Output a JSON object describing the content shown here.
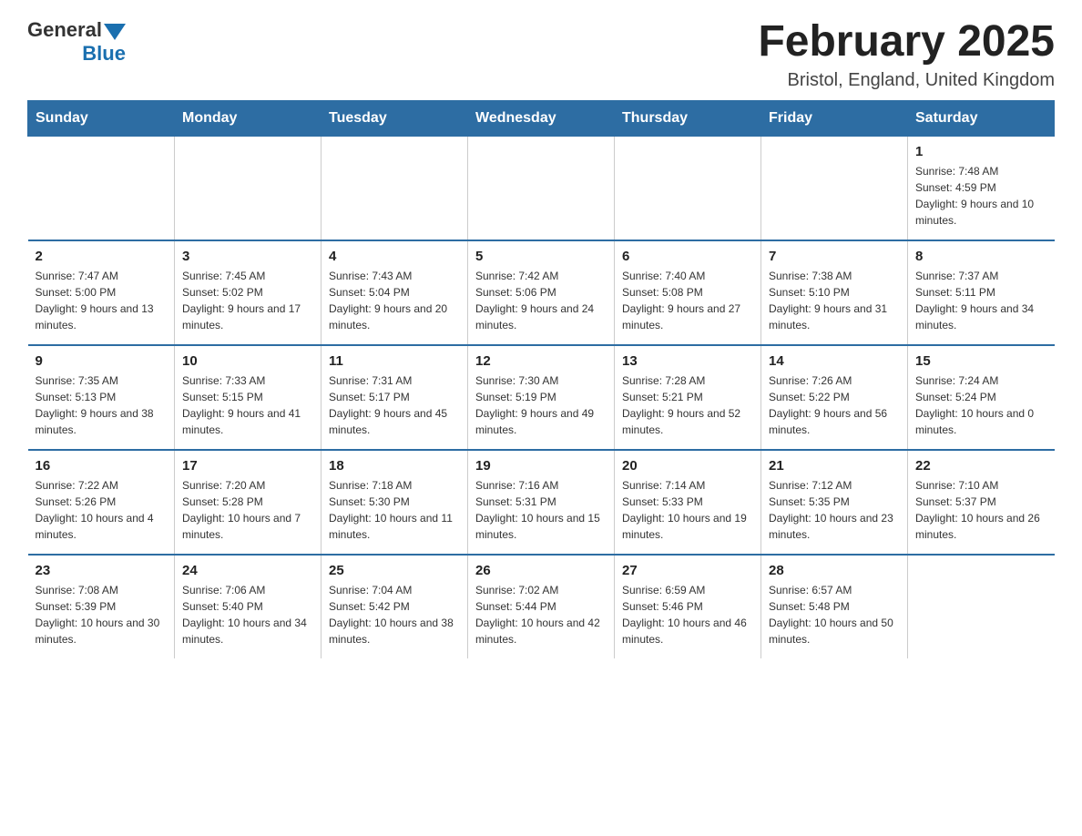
{
  "logo": {
    "text_general": "General",
    "text_blue": "Blue"
  },
  "header": {
    "title": "February 2025",
    "location": "Bristol, England, United Kingdom"
  },
  "weekdays": [
    "Sunday",
    "Monday",
    "Tuesday",
    "Wednesday",
    "Thursday",
    "Friday",
    "Saturday"
  ],
  "weeks": [
    {
      "days": [
        {
          "number": "",
          "info": ""
        },
        {
          "number": "",
          "info": ""
        },
        {
          "number": "",
          "info": ""
        },
        {
          "number": "",
          "info": ""
        },
        {
          "number": "",
          "info": ""
        },
        {
          "number": "",
          "info": ""
        },
        {
          "number": "1",
          "info": "Sunrise: 7:48 AM\nSunset: 4:59 PM\nDaylight: 9 hours and 10 minutes."
        }
      ]
    },
    {
      "days": [
        {
          "number": "2",
          "info": "Sunrise: 7:47 AM\nSunset: 5:00 PM\nDaylight: 9 hours and 13 minutes."
        },
        {
          "number": "3",
          "info": "Sunrise: 7:45 AM\nSunset: 5:02 PM\nDaylight: 9 hours and 17 minutes."
        },
        {
          "number": "4",
          "info": "Sunrise: 7:43 AM\nSunset: 5:04 PM\nDaylight: 9 hours and 20 minutes."
        },
        {
          "number": "5",
          "info": "Sunrise: 7:42 AM\nSunset: 5:06 PM\nDaylight: 9 hours and 24 minutes."
        },
        {
          "number": "6",
          "info": "Sunrise: 7:40 AM\nSunset: 5:08 PM\nDaylight: 9 hours and 27 minutes."
        },
        {
          "number": "7",
          "info": "Sunrise: 7:38 AM\nSunset: 5:10 PM\nDaylight: 9 hours and 31 minutes."
        },
        {
          "number": "8",
          "info": "Sunrise: 7:37 AM\nSunset: 5:11 PM\nDaylight: 9 hours and 34 minutes."
        }
      ]
    },
    {
      "days": [
        {
          "number": "9",
          "info": "Sunrise: 7:35 AM\nSunset: 5:13 PM\nDaylight: 9 hours and 38 minutes."
        },
        {
          "number": "10",
          "info": "Sunrise: 7:33 AM\nSunset: 5:15 PM\nDaylight: 9 hours and 41 minutes."
        },
        {
          "number": "11",
          "info": "Sunrise: 7:31 AM\nSunset: 5:17 PM\nDaylight: 9 hours and 45 minutes."
        },
        {
          "number": "12",
          "info": "Sunrise: 7:30 AM\nSunset: 5:19 PM\nDaylight: 9 hours and 49 minutes."
        },
        {
          "number": "13",
          "info": "Sunrise: 7:28 AM\nSunset: 5:21 PM\nDaylight: 9 hours and 52 minutes."
        },
        {
          "number": "14",
          "info": "Sunrise: 7:26 AM\nSunset: 5:22 PM\nDaylight: 9 hours and 56 minutes."
        },
        {
          "number": "15",
          "info": "Sunrise: 7:24 AM\nSunset: 5:24 PM\nDaylight: 10 hours and 0 minutes."
        }
      ]
    },
    {
      "days": [
        {
          "number": "16",
          "info": "Sunrise: 7:22 AM\nSunset: 5:26 PM\nDaylight: 10 hours and 4 minutes."
        },
        {
          "number": "17",
          "info": "Sunrise: 7:20 AM\nSunset: 5:28 PM\nDaylight: 10 hours and 7 minutes."
        },
        {
          "number": "18",
          "info": "Sunrise: 7:18 AM\nSunset: 5:30 PM\nDaylight: 10 hours and 11 minutes."
        },
        {
          "number": "19",
          "info": "Sunrise: 7:16 AM\nSunset: 5:31 PM\nDaylight: 10 hours and 15 minutes."
        },
        {
          "number": "20",
          "info": "Sunrise: 7:14 AM\nSunset: 5:33 PM\nDaylight: 10 hours and 19 minutes."
        },
        {
          "number": "21",
          "info": "Sunrise: 7:12 AM\nSunset: 5:35 PM\nDaylight: 10 hours and 23 minutes."
        },
        {
          "number": "22",
          "info": "Sunrise: 7:10 AM\nSunset: 5:37 PM\nDaylight: 10 hours and 26 minutes."
        }
      ]
    },
    {
      "days": [
        {
          "number": "23",
          "info": "Sunrise: 7:08 AM\nSunset: 5:39 PM\nDaylight: 10 hours and 30 minutes."
        },
        {
          "number": "24",
          "info": "Sunrise: 7:06 AM\nSunset: 5:40 PM\nDaylight: 10 hours and 34 minutes."
        },
        {
          "number": "25",
          "info": "Sunrise: 7:04 AM\nSunset: 5:42 PM\nDaylight: 10 hours and 38 minutes."
        },
        {
          "number": "26",
          "info": "Sunrise: 7:02 AM\nSunset: 5:44 PM\nDaylight: 10 hours and 42 minutes."
        },
        {
          "number": "27",
          "info": "Sunrise: 6:59 AM\nSunset: 5:46 PM\nDaylight: 10 hours and 46 minutes."
        },
        {
          "number": "28",
          "info": "Sunrise: 6:57 AM\nSunset: 5:48 PM\nDaylight: 10 hours and 50 minutes."
        },
        {
          "number": "",
          "info": ""
        }
      ]
    }
  ]
}
